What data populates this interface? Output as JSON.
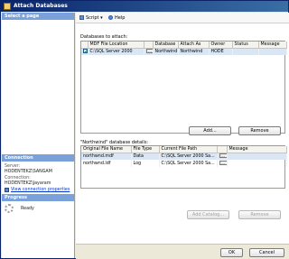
{
  "window": {
    "title": "Attach Databases"
  },
  "sidebar": {
    "select_page": "Select a page",
    "connection_heading": "Connection",
    "server_label": "Server:",
    "server_value": "HODENTEKZ\\SANGAM",
    "connection_label": "Connection:",
    "connection_value": "HODENTEKZ\\Jayaram",
    "view_link": "View connection properties",
    "progress_heading": "Progress",
    "progress_status": "Ready"
  },
  "toolbar": {
    "script": "Script",
    "help": "Help"
  },
  "attach": {
    "label": "Databases to attach:",
    "columns": [
      "",
      "MDF File Location",
      "",
      "Database",
      "Attach As",
      "Owner",
      "Status",
      "Message"
    ],
    "rows": [
      {
        "mdf": "C:\\SQL Server 2000",
        "database": "Northwind",
        "attach_as": "Northwind",
        "owner": "HODE",
        "status": "",
        "message": ""
      }
    ],
    "add_button": "Add...",
    "remove_button": "Remove"
  },
  "details": {
    "label": "\"Northwind\" database details:",
    "columns": [
      "Original File Name",
      "File Type",
      "Current File Path",
      "",
      "Message"
    ],
    "rows": [
      {
        "name": "northwnd.mdf",
        "type": "Data",
        "path": "C:\\SQL Server 2000 Sa...",
        "message": ""
      },
      {
        "name": "northwnd.ldf",
        "type": "Log",
        "path": "C:\\SQL Server 2000 Sa...",
        "message": ""
      }
    ],
    "add_catalog_button": "Add Catalog...",
    "remove_button": "Remove"
  },
  "footer": {
    "ok": "OK",
    "cancel": "Cancel"
  }
}
